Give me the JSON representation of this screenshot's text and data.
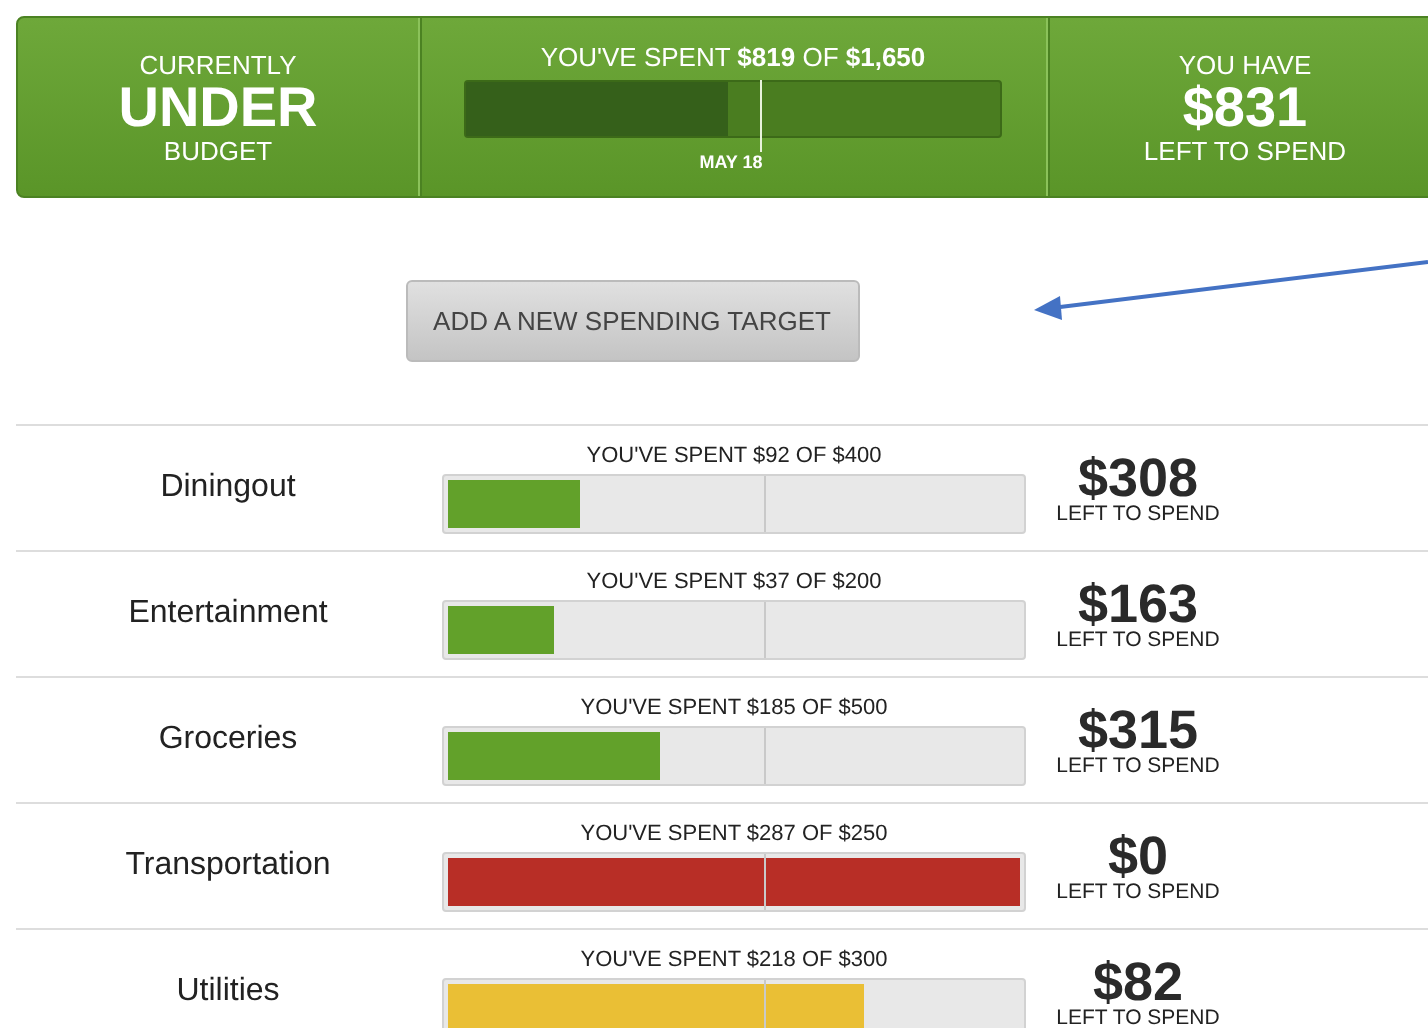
{
  "summary": {
    "status_top": "CURRENTLY",
    "status": "UNDER",
    "status_bottom": "BUDGET",
    "spent_text": "YOU'VE SPENT **$819** OF **$1,650**",
    "level": 0.49,
    "marker_label": "MAY 18",
    "remaining_top": "YOU HAVE",
    "remaining": "$831",
    "remaining_bottom": "LEFT TO SPEND"
  },
  "add_button": "ADD A NEW SPENDING TARGET",
  "budgets": [
    {
      "name": "Diningout",
      "spent_text": "YOU'VE SPENT $92 OF $400",
      "level": 0.23,
      "color": "#62a12a",
      "remaining": "$308",
      "remaining_label": "LEFT TO SPEND"
    },
    {
      "name": "Entertainment",
      "spent_text": "YOU'VE SPENT $37 OF $200",
      "level": 0.185,
      "color": "#62a12a",
      "remaining": "$163",
      "remaining_label": "LEFT TO SPEND"
    },
    {
      "name": "Groceries",
      "spent_text": "YOU'VE SPENT $185 OF $500",
      "level": 0.37,
      "color": "#62a12a",
      "remaining": "$315",
      "remaining_label": "LEFT TO SPEND"
    },
    {
      "name": "Transportation",
      "spent_text": "YOU'VE SPENT $287 OF $250",
      "level": 1,
      "color": "#b82e26",
      "remaining": "$0",
      "remaining_label": "LEFT TO SPEND"
    },
    {
      "name": "Utilities",
      "spent_text": "YOU'VE SPENT $218 OF $300",
      "level": 0.727,
      "color": "#eabf35",
      "remaining": "$82",
      "remaining_label": "LEFT TO SPEND"
    }
  ]
}
